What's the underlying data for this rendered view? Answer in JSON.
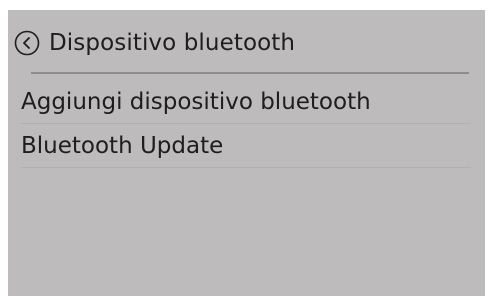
{
  "header": {
    "back_icon": "chevron-left-circle-icon",
    "title": "Dispositivo bluetooth"
  },
  "menu": {
    "items": [
      {
        "label": "Aggiungi dispositivo bluetooth"
      },
      {
        "label": "Bluetooth Update"
      }
    ]
  },
  "colors": {
    "background": "#bdbbbc",
    "text": "#1e1e1e",
    "divider": "#8f8d8e"
  }
}
